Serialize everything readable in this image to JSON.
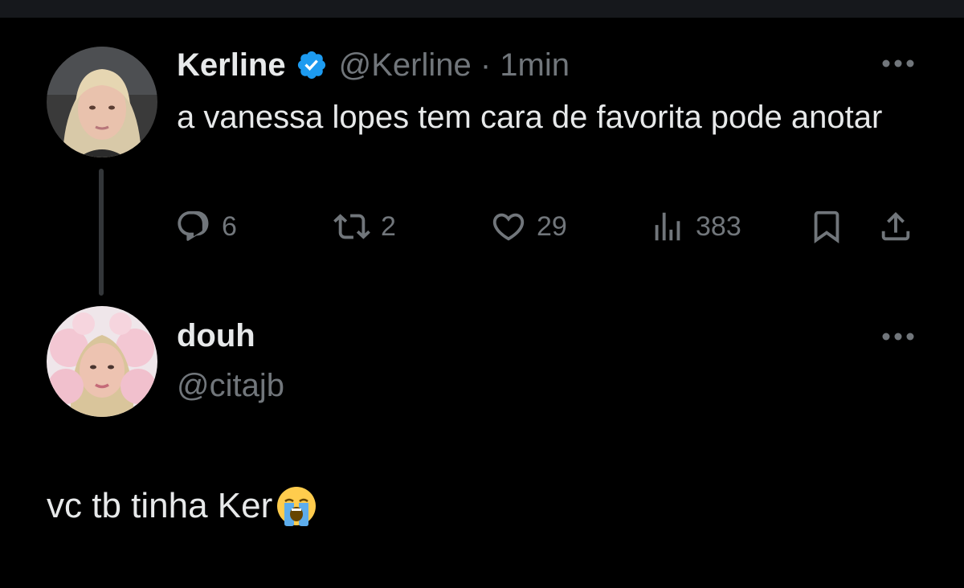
{
  "colors": {
    "background": "#000000",
    "text_primary": "#e7e9ea",
    "text_secondary": "#71767b",
    "verified_blue": "#1d9bf0",
    "thread_line": "#333639"
  },
  "parent_tweet": {
    "display_name": "Kerline",
    "verified_icon": "verified-badge-icon",
    "handle_time": "@Kerline · 1min",
    "text": "a vanessa lopes tem cara de favorita pode anotar",
    "actions": {
      "replies": "6",
      "retweets": "2",
      "likes": "29",
      "views": "383"
    }
  },
  "reply_tweet": {
    "display_name": "douh",
    "handle": "@citajb",
    "text": "vc tb tinha Ker",
    "emoji_icon": "loudly-crying-face-icon"
  }
}
